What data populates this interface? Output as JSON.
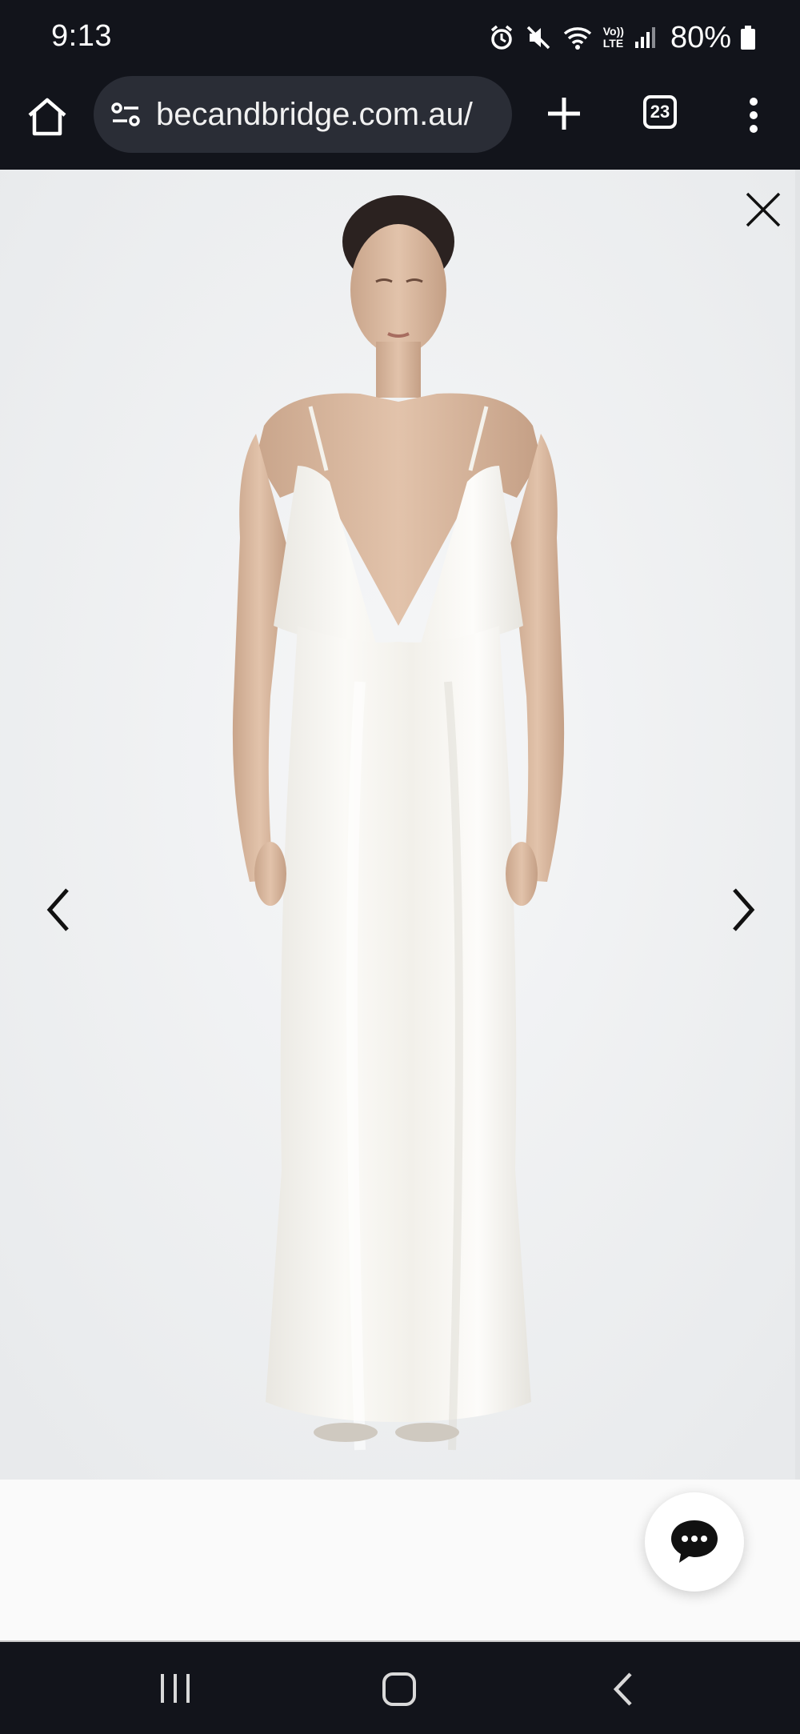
{
  "status_bar": {
    "time": "9:13",
    "icons": [
      "alarm-icon",
      "mute-icon",
      "wifi-icon",
      "volte-icon",
      "signal-icon",
      "battery-icon"
    ],
    "volte_label_top": "Vo))",
    "volte_label_bottom": "LTE",
    "battery_percent": "80%"
  },
  "browser": {
    "url": "becandbridge.com.au/",
    "tab_count": "23"
  },
  "gallery": {
    "image_description": "Model wearing a white satin V-neck slip maxi dress on light grey background"
  },
  "colors": {
    "system_bar": "#12141b",
    "url_pill": "#2a2d36",
    "photo_background": "#eef0f1",
    "dress": "#f7f6f2",
    "skin": "#d9b79e"
  }
}
